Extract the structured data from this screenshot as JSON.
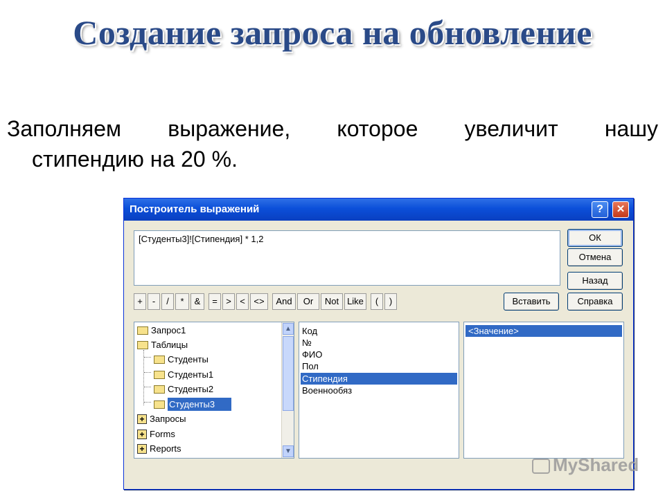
{
  "slide": {
    "title": "Создание запроса на обновление",
    "text_line1": "Заполняем выражение, которое увеличит нашу",
    "text_line2": "стипендию на 20 %."
  },
  "dialog": {
    "title": "Построитель выражений",
    "help_glyph": "?",
    "close_glyph": "✕",
    "expression": "[Студенты3]![Стипендия] * 1,2",
    "buttons": {
      "ok": "ОК",
      "cancel": "Отмена",
      "back": "Назад",
      "insert": "Вставить",
      "help": "Справка"
    },
    "operators": [
      "+",
      "-",
      "/",
      "*",
      "&",
      "=",
      ">",
      "<",
      "<>",
      "And",
      "Or",
      "Not",
      "Like",
      "(",
      ")"
    ],
    "tree": [
      {
        "label": "Запрос1",
        "icon": "folder-icon"
      },
      {
        "label": "Таблицы",
        "icon": "folder-open-icon"
      },
      {
        "label": "Студенты",
        "icon": "folder-icon"
      },
      {
        "label": "Студенты1",
        "icon": "folder-icon"
      },
      {
        "label": "Студенты2",
        "icon": "folder-icon"
      },
      {
        "label": "Студенты3",
        "icon": "folder-open-icon",
        "selected": true
      },
      {
        "label": "Запросы",
        "icon": "plus-folder-icon"
      },
      {
        "label": "Forms",
        "icon": "plus-folder-icon"
      },
      {
        "label": "Reports",
        "icon": "plus-folder-icon"
      }
    ],
    "fields": [
      "Код",
      "№",
      "ФИО",
      "Пол",
      "Стипендия",
      "Военнообяз"
    ],
    "selected_field": "Стипендия",
    "values": [
      "<Значение>"
    ]
  },
  "watermark": {
    "text": "MyShared"
  }
}
